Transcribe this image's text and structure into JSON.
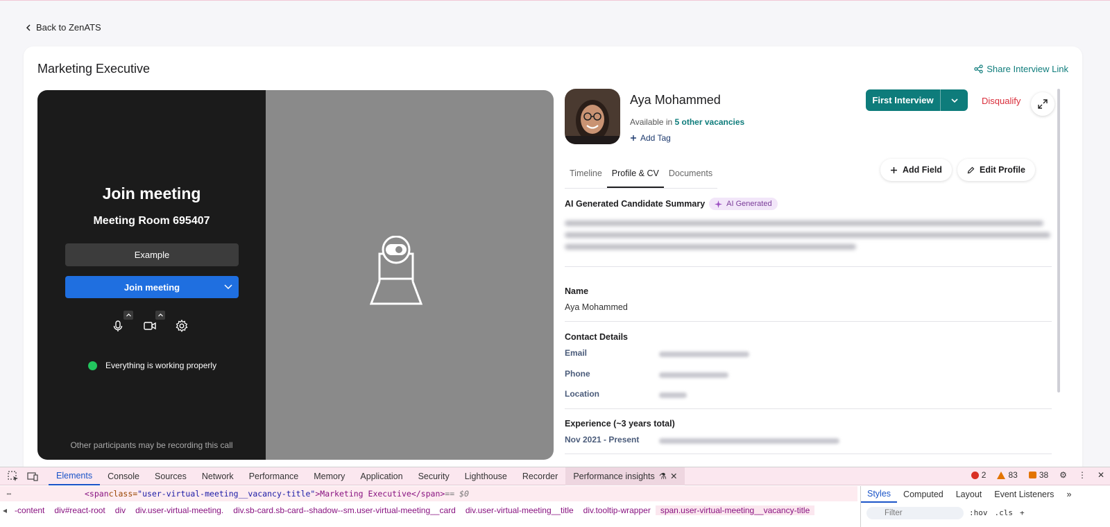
{
  "nav": {
    "back_label": "Back to ZenATS"
  },
  "page": {
    "title": "Marketing Executive",
    "share_label": "Share Interview Link"
  },
  "meeting": {
    "title": "Join meeting",
    "room": "Meeting Room 695407",
    "name_value": "Example",
    "join_label": "Join meeting",
    "status_text": "Everything is working properly",
    "recording_note": "Other participants may be recording this call",
    "colors": {
      "left_bg": "#1b1b1b",
      "right_bg": "#8a8a8a",
      "join_btn": "#1f6fe0",
      "status_ok": "#22c55e"
    }
  },
  "candidate": {
    "name": "Aya Mohammed",
    "available_prefix": "Available in",
    "available_link": "5 other vacancies",
    "add_tag_label": "Add Tag",
    "stage_label": "First Interview",
    "disqualify_label": "Disqualify"
  },
  "tabs": [
    {
      "label": "Timeline",
      "active": false
    },
    {
      "label": "Profile & CV",
      "active": true
    },
    {
      "label": "Documents",
      "active": false
    }
  ],
  "actions": {
    "add_field_label": "Add Field",
    "edit_profile_label": "Edit Profile"
  },
  "summary": {
    "heading": "AI Generated Candidate Summary",
    "badge": "AI Generated"
  },
  "profile": {
    "name_label": "Name",
    "name_value": "Aya Mohammed",
    "contact_heading": "Contact Details",
    "email_label": "Email",
    "phone_label": "Phone",
    "location_label": "Location",
    "experience_heading": "Experience (~3 years total)",
    "experience_dates": "Nov 2021 - Present"
  },
  "devtools": {
    "tabs": [
      "Elements",
      "Console",
      "Sources",
      "Network",
      "Performance",
      "Memory",
      "Application",
      "Security",
      "Lighthouse",
      "Recorder",
      "Performance insights"
    ],
    "errors": "2",
    "warnings": "83",
    "issues": "38",
    "code_tag_open": "<span ",
    "code_attr": "class=",
    "code_val": "\"user-virtual-meeting__vacancy-title\"",
    "code_text": ">Marketing Executive</span>",
    "code_eq": " == $0",
    "breadcrumbs": [
      "-content",
      "div#react-root",
      "div",
      "div.user-virtual-meeting.",
      "div.sb-card.sb-card--shadow--sm.user-virtual-meeting__card",
      "div.user-virtual-meeting__title",
      "div.tooltip-wrapper",
      "span.user-virtual-meeting__vacancy-title"
    ],
    "side_tabs": [
      "Styles",
      "Computed",
      "Layout",
      "Event Listeners"
    ],
    "filter_placeholder": "Filter",
    "hov": ":hov",
    "cls": ".cls",
    "accent": "#1a54c8"
  },
  "brand": {
    "teal": "#0e7c7b",
    "danger": "#d92d3a"
  }
}
